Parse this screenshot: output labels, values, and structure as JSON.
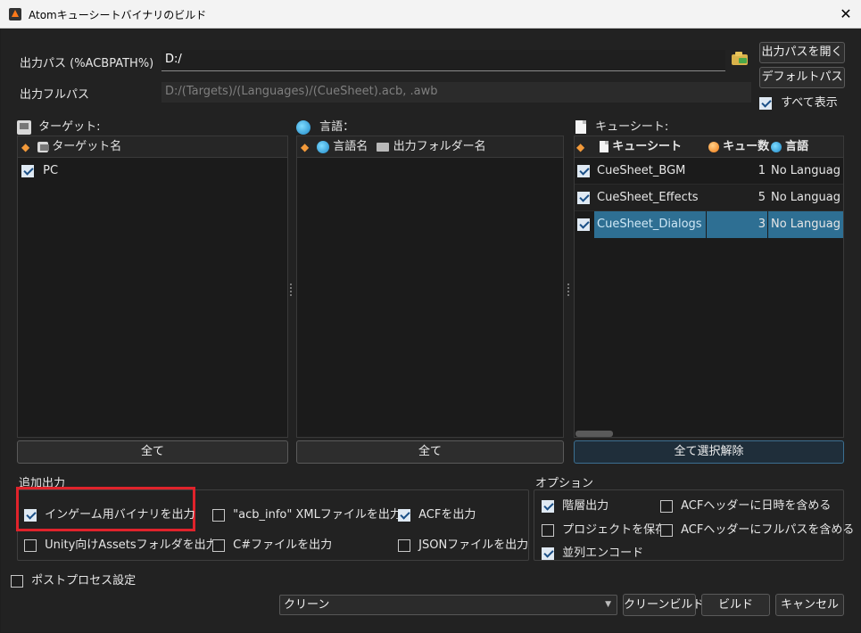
{
  "window": {
    "title": "Atomキューシートバイナリのビルド"
  },
  "output_path": {
    "label": "出力パス (%ACBPATH%)",
    "value": "D:/",
    "open_button": "出力パスを開く",
    "default_button": "デフォルトパス"
  },
  "output_full_path": {
    "label": "出力フルパス",
    "value": "D:/(Targets)/(Languages)/(CueSheet).acb, .awb",
    "show_all_label": "すべて表示",
    "show_all_checked": true
  },
  "targets": {
    "title": "ターゲット:",
    "header": "ターゲット名",
    "rows": [
      {
        "name": "PC",
        "checked": true
      }
    ],
    "all_button": "全て"
  },
  "languages": {
    "title": "言語：",
    "header_name": "言語名",
    "header_folder": "出力フォルダー名",
    "all_button": "全て"
  },
  "cuesheets": {
    "title": "キューシート:",
    "header_cuesheet": "キューシート",
    "header_count": "キュー数",
    "header_language": "言語",
    "rows": [
      {
        "name": "CueSheet_BGM",
        "count": "1",
        "language": "No Languag",
        "checked": true
      },
      {
        "name": "CueSheet_Effects",
        "count": "5",
        "language": "No Languag",
        "checked": true
      },
      {
        "name": "CueSheet_Dialogs",
        "count": "3",
        "language": "No Languag",
        "checked": true
      }
    ],
    "deselect_all_button": "全て選択解除"
  },
  "additional_output": {
    "title": "追加出力",
    "ingame_binary": {
      "label": "インゲーム用バイナリを出力",
      "checked": true
    },
    "acb_info_xml": {
      "label": "\"acb_info\" XMLファイルを出力",
      "checked": false
    },
    "acf": {
      "label": "ACFを出力",
      "checked": true
    },
    "unity_assets": {
      "label": "Unity向けAssetsフォルダを出力",
      "checked": false
    },
    "csharp": {
      "label": "C#ファイルを出力",
      "checked": false
    },
    "json": {
      "label": "JSONファイルを出力",
      "checked": false
    }
  },
  "options": {
    "title": "オプション",
    "hierarchy": {
      "label": "階層出力",
      "checked": true
    },
    "acf_datetime": {
      "label": "ACFヘッダーに日時を含める",
      "checked": false
    },
    "save_project": {
      "label": "プロジェクトを保存",
      "checked": false
    },
    "acf_fullpath": {
      "label": "ACFヘッダーにフルパスを含める",
      "checked": false
    },
    "parallel_encode": {
      "label": "並列エンコード",
      "checked": true
    }
  },
  "postprocess": {
    "label": "ポストプロセス設定",
    "checked": false
  },
  "footer": {
    "mode_value": "クリーン",
    "clean_build_button": "クリーンビルド",
    "build_button": "ビルド",
    "cancel_button": "キャンセル"
  },
  "colors": {
    "selection": "#2e6f93",
    "highlight_box": "#e0232b",
    "accent_orange": "#f07a12"
  }
}
